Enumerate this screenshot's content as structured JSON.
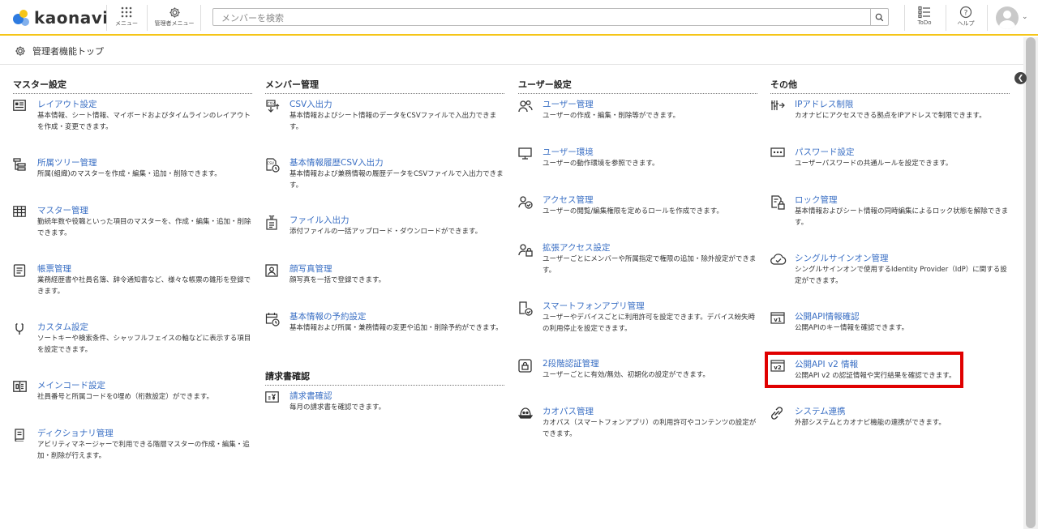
{
  "header": {
    "logo_text": "kaonavi",
    "menu_label": "メニュー",
    "admin_menu_label": "管理者メニュー",
    "search_placeholder": "メンバーを検索",
    "todo_label": "ToDo",
    "help_label": "ヘルプ"
  },
  "breadcrumb": {
    "label": "管理者機能トップ"
  },
  "columns": [
    {
      "title": "マスター設定",
      "items": [
        {
          "name": "レイアウト設定",
          "desc": "基本情報、シート情報、マイボードおよびタイムラインのレイアウトを作成・変更できます。",
          "icon": "layout-icon"
        },
        {
          "name": "所属ツリー管理",
          "desc": "所属(組織)のマスターを作成・編集・追加・削除できます。",
          "icon": "tree-icon"
        },
        {
          "name": "マスター管理",
          "desc": "勤続年数や役職といった項目のマスターを、作成・編集・追加・削除できます。",
          "icon": "table-icon"
        },
        {
          "name": "帳票管理",
          "desc": "業務経歴書や社員名簿、辞令通知書など、様々な帳票の雛形を登録できます。",
          "icon": "form-icon"
        },
        {
          "name": "カスタム設定",
          "desc": "ソートキーや検索条件、シャッフルフェイスの軸などに表示する項目を設定できます。",
          "icon": "custom-icon"
        },
        {
          "name": "メインコード設定",
          "desc": "社員番号と所属コードを0埋め（桁数設定）ができます。",
          "icon": "code-icon"
        },
        {
          "name": "ディクショナリ管理",
          "desc": "アビリティマネージャーで利用できる階層マスターの作成・編集・追加・削除が行えます。",
          "icon": "dictionary-icon"
        }
      ]
    },
    {
      "title": "メンバー管理",
      "items": [
        {
          "name": "CSV入出力",
          "desc": "基本情報およびシート情報のデータをCSVファイルで入出力できます。",
          "icon": "csv-icon"
        },
        {
          "name": "基本情報履歴CSV入出力",
          "desc": "基本情報および兼務情報の履歴データをCSVファイルで入出力できます。",
          "icon": "csv-history-icon"
        },
        {
          "name": "ファイル入出力",
          "desc": "添付ファイルの一括アップロード・ダウンロードができます。",
          "icon": "file-io-icon"
        },
        {
          "name": "顔写真管理",
          "desc": "顔写真を一括で登録できます。",
          "icon": "photo-icon"
        },
        {
          "name": "基本情報の予約設定",
          "desc": "基本情報および所属・兼務情報の変更や追加・削除予約ができます。",
          "icon": "calendar-clock-icon"
        }
      ],
      "section2_title": "請求書確認",
      "section2_items": [
        {
          "name": "請求書確認",
          "desc": "毎月の請求書を確認できます。",
          "icon": "invoice-icon"
        }
      ]
    },
    {
      "title": "ユーザー設定",
      "items": [
        {
          "name": "ユーザー管理",
          "desc": "ユーザーの作成・編集・削除等ができます。",
          "icon": "users-icon"
        },
        {
          "name": "ユーザー環境",
          "desc": "ユーザーの動作環境を参照できます。",
          "icon": "monitor-icon"
        },
        {
          "name": "アクセス管理",
          "desc": "ユーザーの閲覧/編集権限を定めるロールを作成できます。",
          "icon": "user-check-icon"
        },
        {
          "name": "拡張アクセス設定",
          "desc": "ユーザーごとにメンバーや所属指定で権限の追加・除外設定ができます。",
          "icon": "user-lock-icon"
        },
        {
          "name": "スマートフォンアプリ管理",
          "desc": "ユーザーやデバイスごとに利用許可を設定できます。デバイス紛失時の利用停止を設定できます。",
          "icon": "phone-check-icon"
        },
        {
          "name": "2段階認証管理",
          "desc": "ユーザーごとに有効/無効、初期化の設定ができます。",
          "icon": "two-factor-icon"
        },
        {
          "name": "カオパス管理",
          "desc": "カオパス（スマートフォンアプリ）の利用許可やコンテンツの設定ができます。",
          "icon": "kaopass-icon"
        }
      ]
    },
    {
      "title": "その他",
      "items": [
        {
          "name": "IPアドレス制限",
          "desc": "カオナビにアクセスできる拠点をIPアドレスで制限できます。",
          "icon": "ip-icon"
        },
        {
          "name": "パスワード設定",
          "desc": "ユーザーパスワードの共通ルールを設定できます。",
          "icon": "password-icon"
        },
        {
          "name": "ロック管理",
          "desc": "基本情報およびシート情報の同時編集によるロック状態を解除できます。",
          "icon": "lock-doc-icon"
        },
        {
          "name": "シングルサインオン管理",
          "desc": "シングルサインオンで使用するIdentity Provider（IdP）に関する設定ができます。",
          "icon": "cloud-check-icon"
        },
        {
          "name": "公開API情報確認",
          "desc": "公開APIのキー情報を確認できます。",
          "icon": "api-v1-icon"
        },
        {
          "name": "公開API v2 情報",
          "desc": "公開API v2 の認証情報や実行結果を確認できます。",
          "icon": "api-v2-icon"
        },
        {
          "name": "システム連携",
          "desc": "外部システムとカオナビ機能の連携ができます。",
          "icon": "link-icon"
        }
      ]
    }
  ],
  "colors": {
    "link": "#3a6fc4",
    "header_border": "#f5c518",
    "highlight": "#e00000"
  }
}
